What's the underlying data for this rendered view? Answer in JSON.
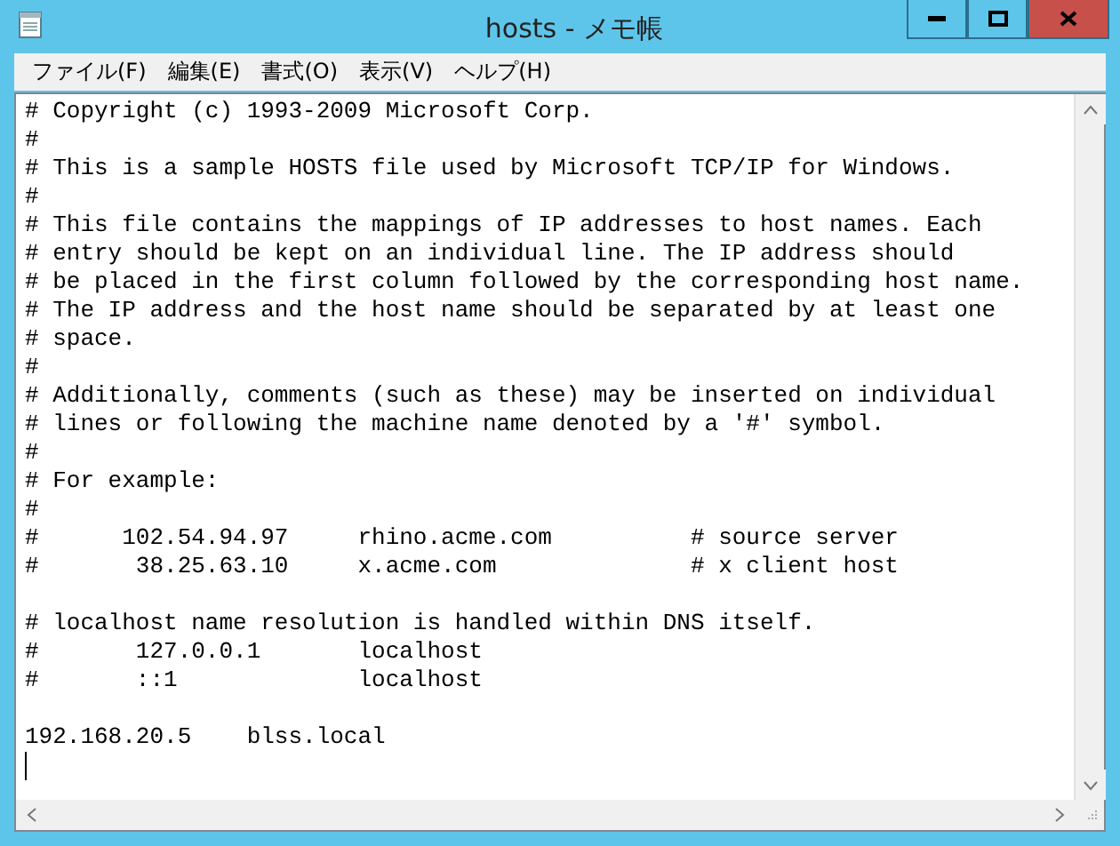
{
  "window": {
    "title": "hosts - メモ帳"
  },
  "menu": [
    "ファイル(F)",
    "編集(E)",
    "書式(O)",
    "表示(V)",
    "ヘルプ(H)"
  ],
  "editor": {
    "blocks": [
      [
        "# Copyright (c) 1993-2009 Microsoft Corp.",
        "#",
        "# This is a sample HOSTS file used by Microsoft TCP/IP for Windows.",
        "#",
        "# This file contains the mappings of IP addresses to host names. Each",
        "# entry should be kept on an individual line. The IP address should",
        "# be placed in the first column followed by the corresponding host name.",
        "# The IP address and the host name should be separated by at least one",
        "# space.",
        "#",
        "# Additionally, comments (such as these) may be inserted on individual",
        "# lines or following the machine name denoted by a '#' symbol.",
        "#",
        "# For example:",
        "#",
        "#      102.54.94.97     rhino.acme.com          # source server",
        "#       38.25.63.10     x.acme.com              # x client host"
      ],
      [
        "# localhost name resolution is handled within DNS itself.",
        "#\t127.0.0.1       localhost",
        "#\t::1             localhost"
      ],
      [
        "192.168.20.5\tblss.local"
      ]
    ]
  }
}
